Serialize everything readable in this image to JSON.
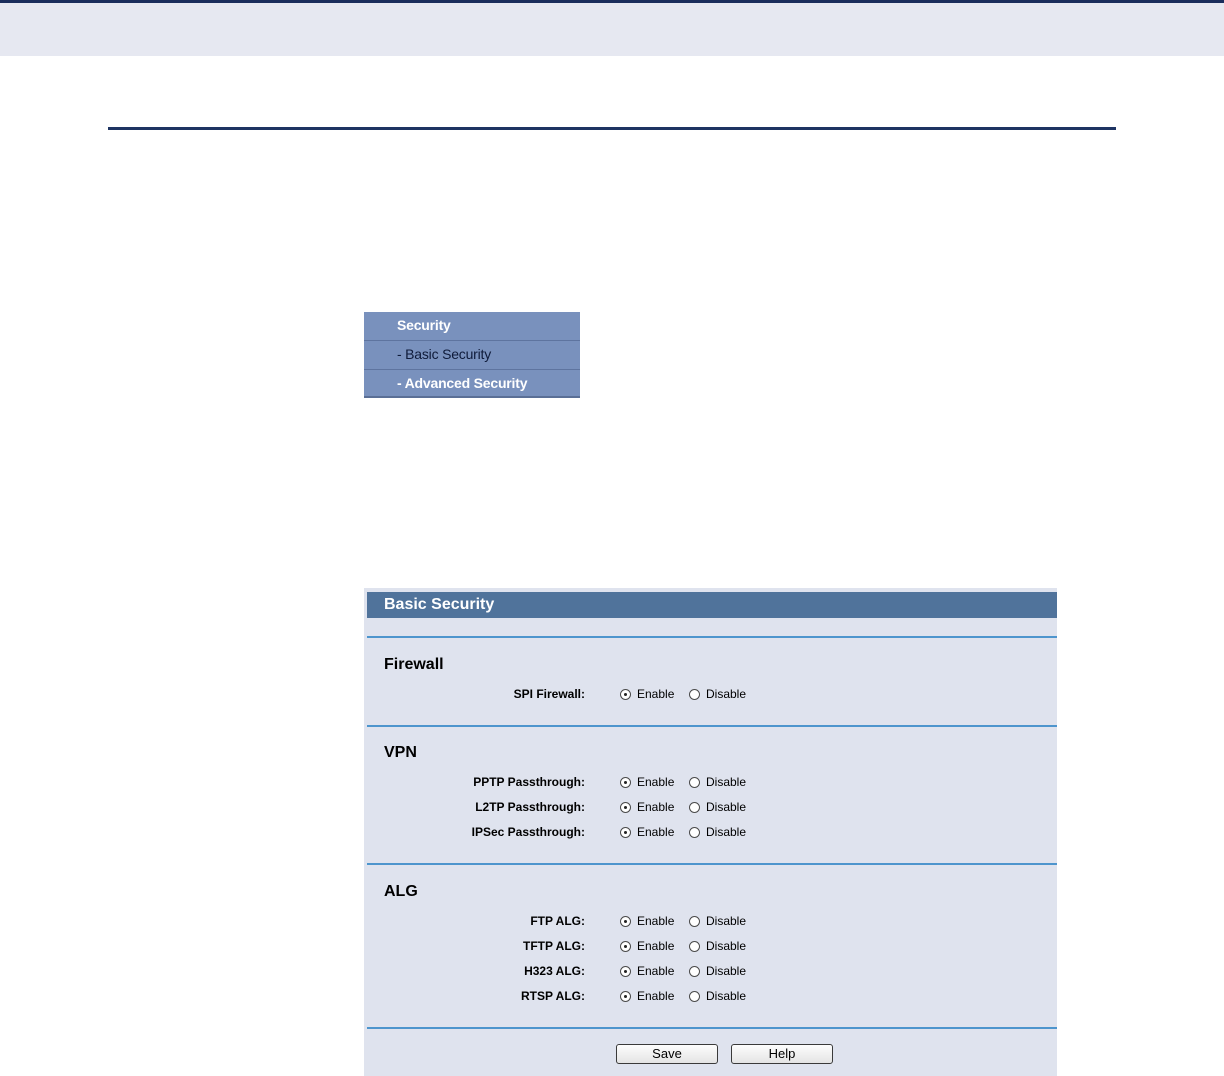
{
  "menu": {
    "items": [
      {
        "label": "Security"
      },
      {
        "label": "- Basic Security"
      },
      {
        "label": "- Advanced Security"
      }
    ]
  },
  "panel": {
    "title": "Basic Security",
    "sections": {
      "firewall": {
        "title": "Firewall"
      },
      "vpn": {
        "title": "VPN"
      },
      "alg": {
        "title": "ALG"
      }
    },
    "rows": [
      {
        "label": "SPI Firewall:",
        "enable": "Enable",
        "disable": "Disable",
        "selected": "Enable"
      },
      {
        "label": "PPTP Passthrough:",
        "enable": "Enable",
        "disable": "Disable",
        "selected": "Enable"
      },
      {
        "label": "L2TP Passthrough:",
        "enable": "Enable",
        "disable": "Disable",
        "selected": "Enable"
      },
      {
        "label": "IPSec Passthrough:",
        "enable": "Enable",
        "disable": "Disable",
        "selected": "Enable"
      },
      {
        "label": "FTP ALG:",
        "enable": "Enable",
        "disable": "Disable",
        "selected": "Enable"
      },
      {
        "label": "TFTP ALG:",
        "enable": "Enable",
        "disable": "Disable",
        "selected": "Enable"
      },
      {
        "label": "H323 ALG:",
        "enable": "Enable",
        "disable": "Disable",
        "selected": "Enable"
      },
      {
        "label": "RTSP ALG:",
        "enable": "Enable",
        "disable": "Disable",
        "selected": "Enable"
      }
    ],
    "buttons": {
      "save": "Save",
      "help": "Help"
    }
  },
  "colors": {
    "header_bar": "#50739b",
    "menu_bg": "#7991bd",
    "panel_bg": "#dfe3ee",
    "divider": "#4e95cd"
  }
}
